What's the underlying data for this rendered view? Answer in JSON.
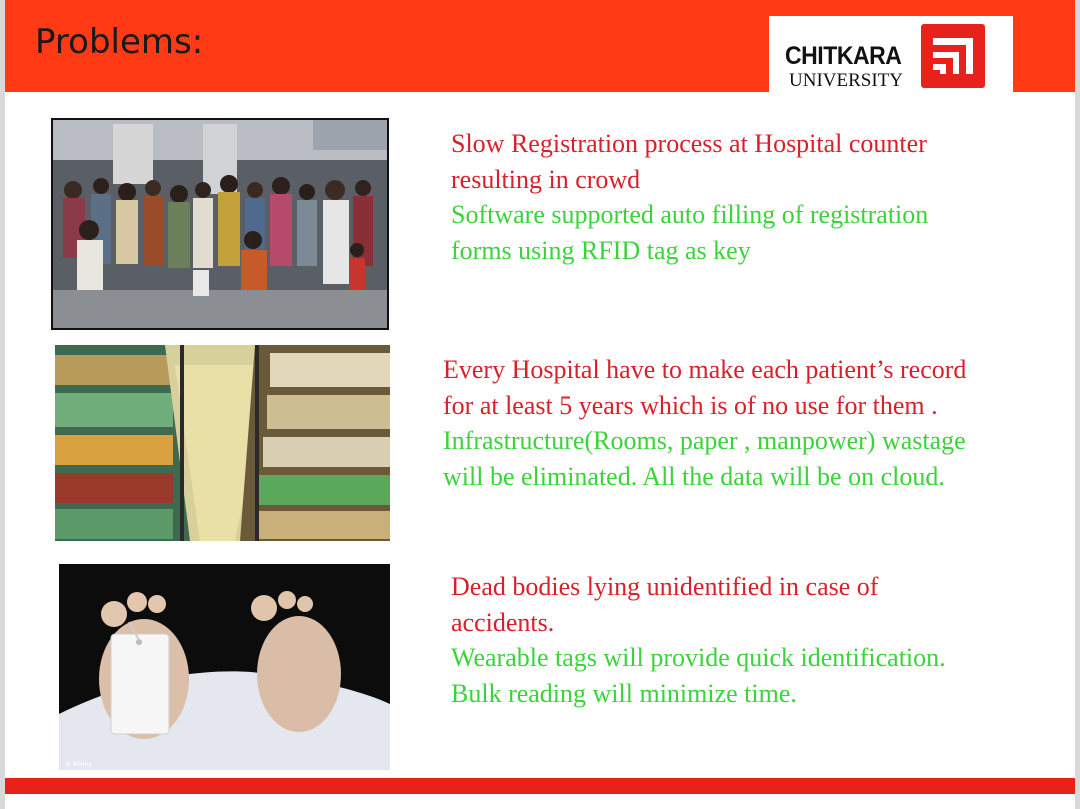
{
  "slide": {
    "title": "Problems:",
    "logo": {
      "name": "CHITKARA",
      "sub": "UNIVERSITY"
    }
  },
  "items": [
    {
      "problem": [
        "Slow Registration process at Hospital counter",
        "resulting in crowd"
      ],
      "solution": [
        "Software supported auto filling of registration",
        "forms using RFID tag as key"
      ],
      "image": "hospital-crowd-photo"
    },
    {
      "problem": [
        "Every Hospital have to make each patient’s record",
        "for at least 5 years which is of no use for them ."
      ],
      "solution": [
        "Infrastructure(Rooms, paper , manpower) wastage",
        "will be eliminated. All the data will be on cloud."
      ],
      "image": "file-archive-photo"
    },
    {
      "problem": [
        "Dead bodies lying unidentified in case of",
        "accidents."
      ],
      "solution": [
        "Wearable tags will provide quick identification.",
        "Bulk reading will minimize time."
      ],
      "image": "toe-tag-photo",
      "credit": "© Alamy"
    }
  ],
  "colors": {
    "header": "#ff3a14",
    "problem": "#d9202a",
    "solution": "#3ad43a",
    "footer": "#e8211b"
  }
}
